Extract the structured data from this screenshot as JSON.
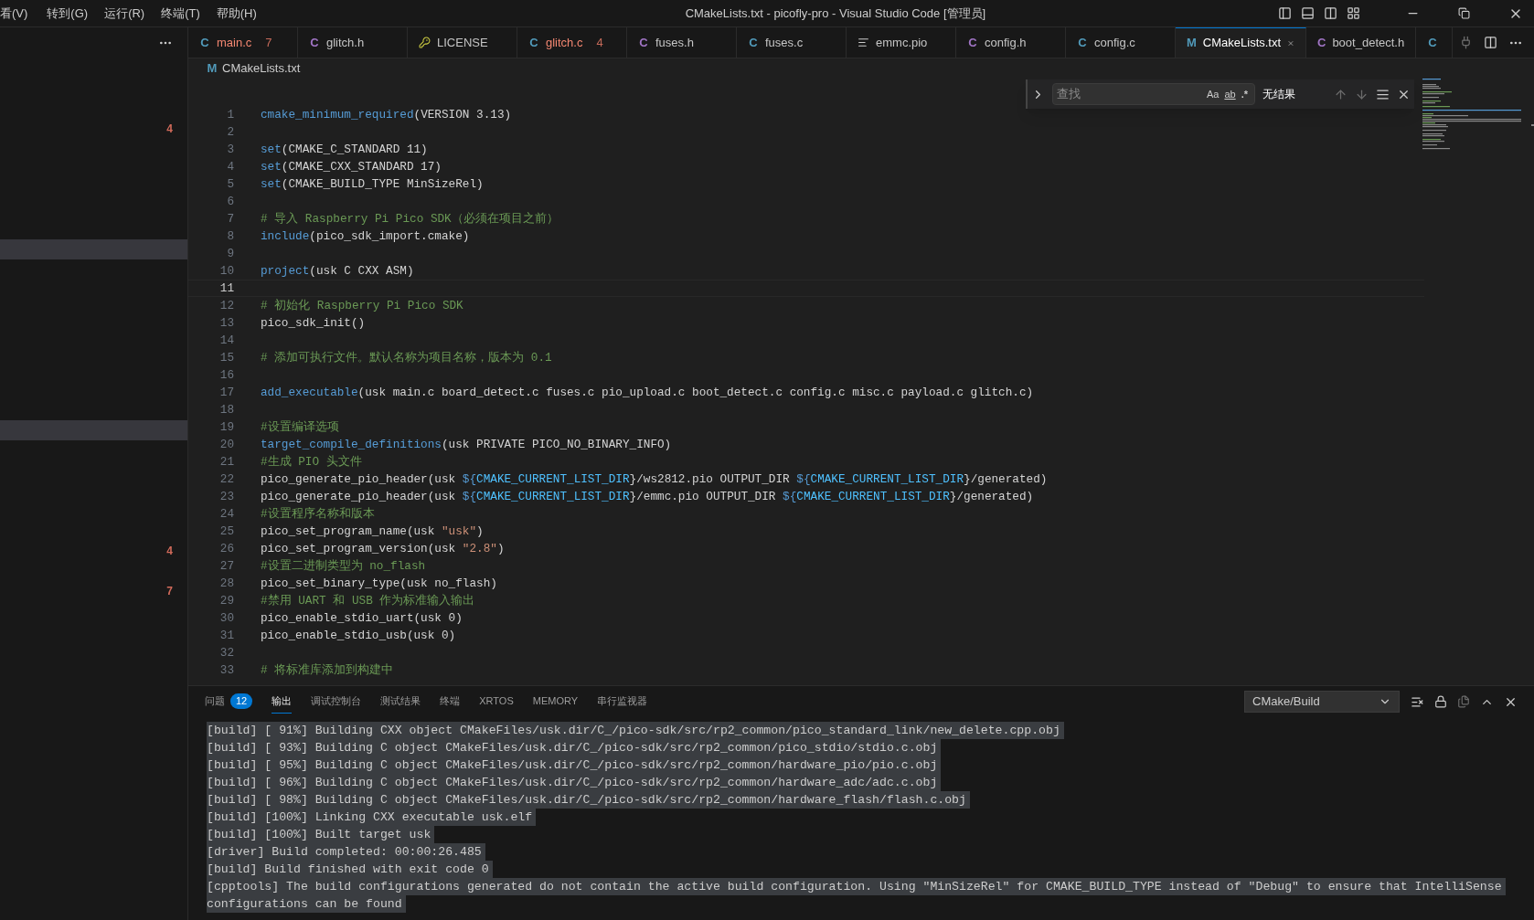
{
  "title_bar": {
    "menus": [
      "看(V)",
      "转到(G)",
      "运行(R)",
      "终端(T)",
      "帮助(H)"
    ],
    "title": "CMakeLists.txt - picofly-pro - Visual Studio Code [管理员]"
  },
  "sidebar": {
    "rows": [
      {
        "highlighted": false
      },
      {
        "highlighted": false
      },
      {
        "highlighted": false
      },
      {
        "highlighted": false,
        "badge": "4"
      },
      {
        "highlighted": false
      },
      {
        "highlighted": false
      },
      {
        "highlighted": false
      },
      {
        "highlighted": false
      },
      {
        "highlighted": false
      },
      {
        "highlighted": true
      },
      {
        "highlighted": false
      },
      {
        "highlighted": false
      },
      {
        "highlighted": false
      },
      {
        "highlighted": false
      },
      {
        "highlighted": false
      },
      {
        "highlighted": false
      },
      {
        "highlighted": false
      },
      {
        "highlighted": false
      },
      {
        "highlighted": true
      },
      {
        "highlighted": false
      },
      {
        "highlighted": false
      },
      {
        "highlighted": false
      },
      {
        "highlighted": false
      },
      {
        "highlighted": false
      },
      {
        "highlighted": false,
        "badge": "4"
      },
      {
        "highlighted": false
      },
      {
        "highlighted": false,
        "badge": "7"
      }
    ]
  },
  "tabs": [
    {
      "label": "main.c",
      "icon": {
        "kind": "c",
        "glyph": "C"
      },
      "error": true,
      "count": "7",
      "selected": false
    },
    {
      "label": "glitch.h",
      "icon": {
        "kind": "h",
        "glyph": "C"
      },
      "error": false,
      "selected": false
    },
    {
      "label": "LICENSE",
      "icon": {
        "kind": "license"
      },
      "error": false,
      "selected": false
    },
    {
      "label": "glitch.c",
      "icon": {
        "kind": "c",
        "glyph": "C"
      },
      "error": true,
      "count": "4",
      "selected": false
    },
    {
      "label": "fuses.h",
      "icon": {
        "kind": "h",
        "glyph": "C"
      },
      "error": false,
      "selected": false
    },
    {
      "label": "fuses.c",
      "icon": {
        "kind": "c",
        "glyph": "C"
      },
      "error": false,
      "selected": false
    },
    {
      "label": "emmc.pio",
      "icon": {
        "kind": "pio"
      },
      "error": false,
      "selected": false
    },
    {
      "label": "config.h",
      "icon": {
        "kind": "h",
        "glyph": "C"
      },
      "error": false,
      "selected": false
    },
    {
      "label": "config.c",
      "icon": {
        "kind": "c",
        "glyph": "C"
      },
      "error": false,
      "selected": false
    },
    {
      "label": "CMakeLists.txt",
      "icon": {
        "kind": "cmake",
        "glyph": "M"
      },
      "error": false,
      "selected": true
    },
    {
      "label": "boot_detect.h",
      "icon": {
        "kind": "h",
        "glyph": "C"
      },
      "error": false,
      "selected": false
    },
    {
      "icon": {
        "kind": "c",
        "glyph": "C"
      },
      "selected": false
    }
  ],
  "breadcrumb": {
    "icon": {
      "kind": "cmake",
      "glyph": "M"
    },
    "label": "CMakeLists.txt"
  },
  "find": {
    "placeholder": "查找",
    "options": [
      "Aa",
      "ab",
      ".*"
    ],
    "result": "无结果"
  },
  "code": [
    {
      "number": "1",
      "current": false,
      "tokens": [
        {
          "kind": "cmd",
          "text": "cmake_minimum_required"
        },
        {
          "kind": "text",
          "text": "(VERSION 3.13)"
        }
      ]
    },
    {
      "number": "2",
      "current": false
    },
    {
      "number": "3",
      "current": false,
      "tokens": [
        {
          "kind": "cmd",
          "text": "set"
        },
        {
          "kind": "text",
          "text": "(CMAKE_C_STANDARD 11)"
        }
      ]
    },
    {
      "number": "4",
      "current": false,
      "tokens": [
        {
          "kind": "cmd",
          "text": "set"
        },
        {
          "kind": "text",
          "text": "(CMAKE_CXX_STANDARD 17)"
        }
      ]
    },
    {
      "number": "5",
      "current": false,
      "tokens": [
        {
          "kind": "cmd",
          "text": "set"
        },
        {
          "kind": "text",
          "text": "(CMAKE_BUILD_TYPE MinSizeRel)"
        }
      ]
    },
    {
      "number": "6",
      "current": false
    },
    {
      "number": "7",
      "current": false,
      "tokens": [
        {
          "kind": "comment",
          "text": "# 导入 Raspberry Pi Pico SDK（必须在项目之前）"
        }
      ]
    },
    {
      "number": "8",
      "current": false,
      "tokens": [
        {
          "kind": "cmd",
          "text": "include"
        },
        {
          "kind": "text",
          "text": "(pico_sdk_import.cmake)"
        }
      ]
    },
    {
      "number": "9",
      "current": false
    },
    {
      "number": "10",
      "current": false,
      "tokens": [
        {
          "kind": "cmd",
          "text": "project"
        },
        {
          "kind": "text",
          "text": "(usk C CXX ASM)"
        }
      ]
    },
    {
      "number": "11",
      "current": true
    },
    {
      "number": "12",
      "current": false,
      "tokens": [
        {
          "kind": "comment",
          "text": "# 初始化 Raspberry Pi Pico SDK"
        }
      ]
    },
    {
      "number": "13",
      "current": false,
      "tokens": [
        {
          "kind": "text",
          "text": "pico_sdk_init()"
        }
      ]
    },
    {
      "number": "14",
      "current": false
    },
    {
      "number": "15",
      "current": false,
      "tokens": [
        {
          "kind": "comment",
          "text": "# 添加可执行文件。默认名称为项目名称，版本为 0.1"
        }
      ]
    },
    {
      "number": "16",
      "current": false
    },
    {
      "number": "17",
      "current": false,
      "tokens": [
        {
          "kind": "cmd",
          "text": "add_executable"
        },
        {
          "kind": "text",
          "text": "(usk main.c board_detect.c fuses.c pio_upload.c boot_detect.c config.c misc.c payload.c glitch.c)"
        }
      ]
    },
    {
      "number": "18",
      "current": false
    },
    {
      "number": "19",
      "current": false,
      "tokens": [
        {
          "kind": "comment",
          "text": "#设置编译选项"
        }
      ]
    },
    {
      "number": "20",
      "current": false,
      "tokens": [
        {
          "kind": "cmd",
          "text": "target_compile_definitions"
        },
        {
          "kind": "text",
          "text": "(usk PRIVATE PICO_NO_BINARY_INFO)"
        }
      ]
    },
    {
      "number": "21",
      "current": false,
      "tokens": [
        {
          "kind": "comment",
          "text": "#生成 PIO 头文件"
        }
      ]
    },
    {
      "number": "22",
      "current": false,
      "tokens": [
        {
          "kind": "text",
          "text": "pico_generate_pio_header(usk "
        },
        {
          "kind": "brace",
          "text": "${"
        },
        {
          "kind": "var",
          "text": "CMAKE_CURRENT_LIST_DIR"
        },
        {
          "kind": "text",
          "text": "}/ws2812.pio OUTPUT_DIR "
        },
        {
          "kind": "brace",
          "text": "${"
        },
        {
          "kind": "var",
          "text": "CMAKE_CURRENT_LIST_DIR"
        },
        {
          "kind": "text",
          "text": "}/generated)"
        }
      ]
    },
    {
      "number": "23",
      "current": false,
      "tokens": [
        {
          "kind": "text",
          "text": "pico_generate_pio_header(usk "
        },
        {
          "kind": "brace",
          "text": "${"
        },
        {
          "kind": "var",
          "text": "CMAKE_CURRENT_LIST_DIR"
        },
        {
          "kind": "text",
          "text": "}/emmc.pio OUTPUT_DIR "
        },
        {
          "kind": "brace",
          "text": "${"
        },
        {
          "kind": "var",
          "text": "CMAKE_CURRENT_LIST_DIR"
        },
        {
          "kind": "text",
          "text": "}/generated)"
        }
      ]
    },
    {
      "number": "24",
      "current": false,
      "tokens": [
        {
          "kind": "comment",
          "text": "#设置程序名称和版本"
        }
      ]
    },
    {
      "number": "25",
      "current": false,
      "tokens": [
        {
          "kind": "text",
          "text": "pico_set_program_name(usk "
        },
        {
          "kind": "string",
          "text": "\"usk\""
        },
        {
          "kind": "text",
          "text": ")"
        }
      ]
    },
    {
      "number": "26",
      "current": false,
      "tokens": [
        {
          "kind": "text",
          "text": "pico_set_program_version(usk "
        },
        {
          "kind": "string",
          "text": "\"2.8\""
        },
        {
          "kind": "text",
          "text": ")"
        }
      ]
    },
    {
      "number": "27",
      "current": false,
      "tokens": [
        {
          "kind": "comment",
          "text": "#设置二进制类型为 no_flash"
        }
      ]
    },
    {
      "number": "28",
      "current": false,
      "tokens": [
        {
          "kind": "text",
          "text": "pico_set_binary_type(usk no_flash)"
        }
      ]
    },
    {
      "number": "29",
      "current": false,
      "tokens": [
        {
          "kind": "comment",
          "text": "#禁用 UART 和 USB 作为标准输入输出"
        }
      ]
    },
    {
      "number": "30",
      "current": false,
      "tokens": [
        {
          "kind": "text",
          "text": "pico_enable_stdio_uart(usk 0)"
        }
      ]
    },
    {
      "number": "31",
      "current": false,
      "tokens": [
        {
          "kind": "text",
          "text": "pico_enable_stdio_usb(usk 0)"
        }
      ]
    },
    {
      "number": "32",
      "current": false
    },
    {
      "number": "33",
      "current": false,
      "tokens": [
        {
          "kind": "comment",
          "text": "# 将标准库添加到构建中"
        }
      ]
    }
  ],
  "panel": {
    "tabs": [
      {
        "label": "问题",
        "badge": "12",
        "selected": false
      },
      {
        "label": "输出",
        "selected": true
      },
      {
        "label": "调试控制台",
        "selected": false
      },
      {
        "label": "测试结果",
        "selected": false
      },
      {
        "label": "终端",
        "selected": false
      },
      {
        "label": "XRTOS",
        "selected": false
      },
      {
        "label": "MEMORY",
        "selected": false
      },
      {
        "label": "串行监视器",
        "selected": false
      }
    ],
    "channel": "CMake/Build",
    "output": [
      "[build] [ 91%] Building CXX object CMakeFiles/usk.dir/C_/pico-sdk/src/rp2_common/pico_standard_link/new_delete.cpp.obj",
      "[build] [ 93%] Building C object CMakeFiles/usk.dir/C_/pico-sdk/src/rp2_common/pico_stdio/stdio.c.obj",
      "[build] [ 95%] Building C object CMakeFiles/usk.dir/C_/pico-sdk/src/rp2_common/hardware_pio/pio.c.obj",
      "[build] [ 96%] Building C object CMakeFiles/usk.dir/C_/pico-sdk/src/rp2_common/hardware_adc/adc.c.obj",
      "[build] [ 98%] Building C object CMakeFiles/usk.dir/C_/pico-sdk/src/rp2_common/hardware_flash/flash.c.obj",
      "[build] [100%] Linking CXX executable usk.elf",
      "[build] [100%] Built target usk",
      "[driver] Build completed: 00:00:26.485",
      "[build] Build finished with exit code 0",
      "[cpptools] The build configurations generated do not contain the active build configuration. Using \"MinSizeRel\" for CMAKE_BUILD_TYPE instead of \"Debug\" to ensure that IntelliSense",
      "configurations can be found"
    ]
  }
}
